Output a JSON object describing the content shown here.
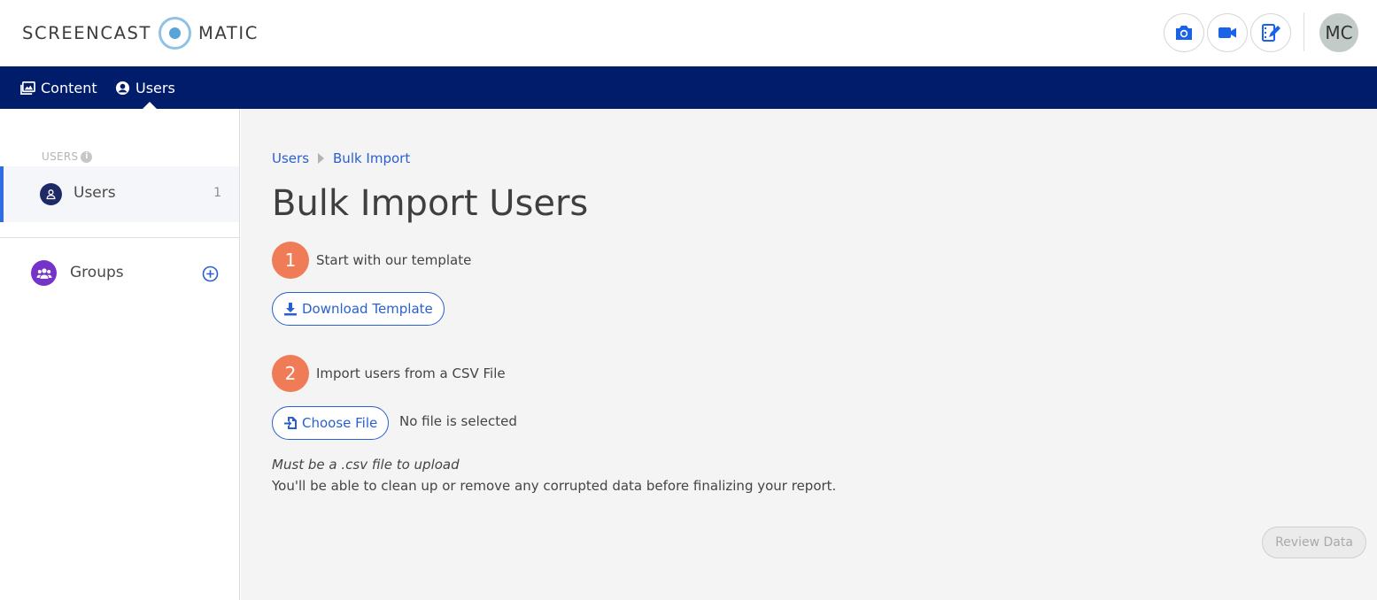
{
  "app": {
    "logo_left": "SCREENCAST",
    "logo_right": "MATIC",
    "toolbar": {
      "camera_icon": "camera-icon",
      "video_icon": "video-icon",
      "editor_icon": "video-editor-icon"
    },
    "avatar_initials": "MC"
  },
  "nav": {
    "items": [
      {
        "label": "Content",
        "icon": "content-icon"
      },
      {
        "label": "Users",
        "icon": "user-circle-icon",
        "active": true
      }
    ]
  },
  "sidebar": {
    "section_label": "USERS",
    "section_info": "i",
    "users": {
      "label": "Users",
      "count": "1"
    },
    "groups": {
      "label": "Groups"
    }
  },
  "main": {
    "breadcrumb": [
      "Users",
      "Bulk Import"
    ],
    "title": "Bulk Import Users",
    "step1": {
      "number": "1",
      "text": "Start with our template",
      "button": "Download Template"
    },
    "step2": {
      "number": "2",
      "text": "Import users from a CSV File",
      "button": "Choose File",
      "file_status": "No file is selected"
    },
    "note_italic": "Must be a .csv file to upload",
    "note": "You'll be able to clean up or remove any corrupted data before finalizing your report.",
    "review_button": "Review Data"
  },
  "colors": {
    "navbar": "#001c6b",
    "accent": "#2a5fd0",
    "step_badge": "#f07b57",
    "groups_icon": "#7533c9"
  }
}
